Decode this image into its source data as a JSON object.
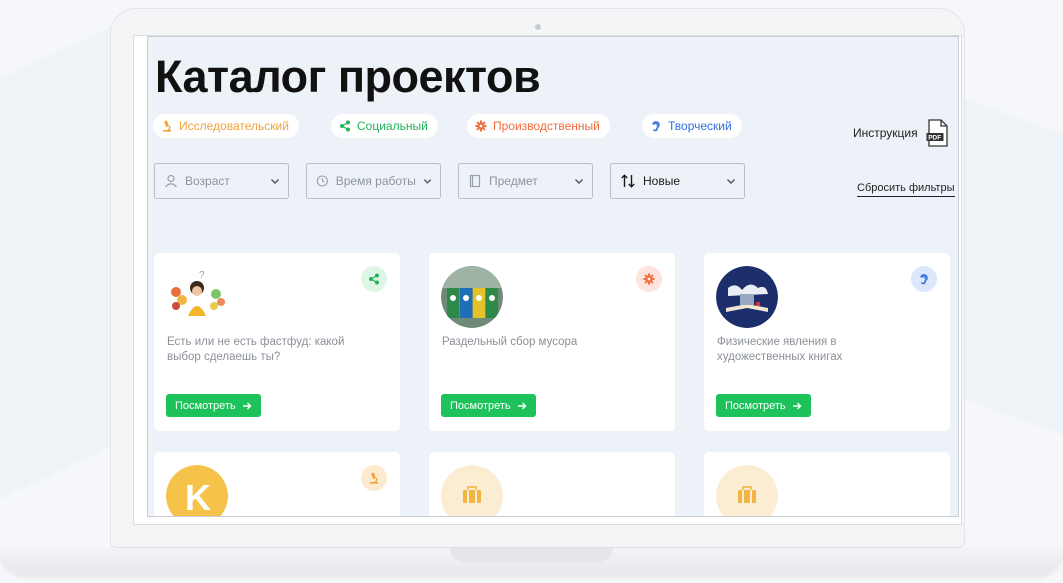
{
  "page": {
    "title": "Каталог проектов"
  },
  "categories": [
    {
      "label": "Исследовательский",
      "color": "#f0a33a"
    },
    {
      "label": "Социальный",
      "color": "#22b35a"
    },
    {
      "label": "Производственный",
      "color": "#f26b3a"
    },
    {
      "label": "Творческий",
      "color": "#2f6fdd"
    }
  ],
  "instruction": {
    "label": "Инструкция",
    "icon_text": "PDF"
  },
  "filters": {
    "age": "Возраст",
    "time": "Время работы",
    "subject": "Предмет",
    "sort": "Новые"
  },
  "reset_label": "Сбросить фильтры",
  "cards": [
    {
      "title": "Есть или не есть фастфуд: какой выбор сделаешь ты?",
      "type": "social",
      "button": "Посмотреть"
    },
    {
      "title": "Раздельный сбор мусора",
      "type": "production",
      "button": "Посмотреть"
    },
    {
      "title": "Физические явления в художественных книгах",
      "type": "creative",
      "button": "Посмотреть"
    },
    {
      "title": "",
      "type": "research",
      "thumb_letter": "K"
    },
    {
      "title": "",
      "type": ""
    },
    {
      "title": "",
      "type": ""
    }
  ],
  "colors": {
    "accent_green": "#1dc35a",
    "screen_bg": "#edf2f9",
    "research": "#f0a33a",
    "social": "#22b35a",
    "production": "#f26b3a",
    "creative": "#2f6fdd"
  }
}
